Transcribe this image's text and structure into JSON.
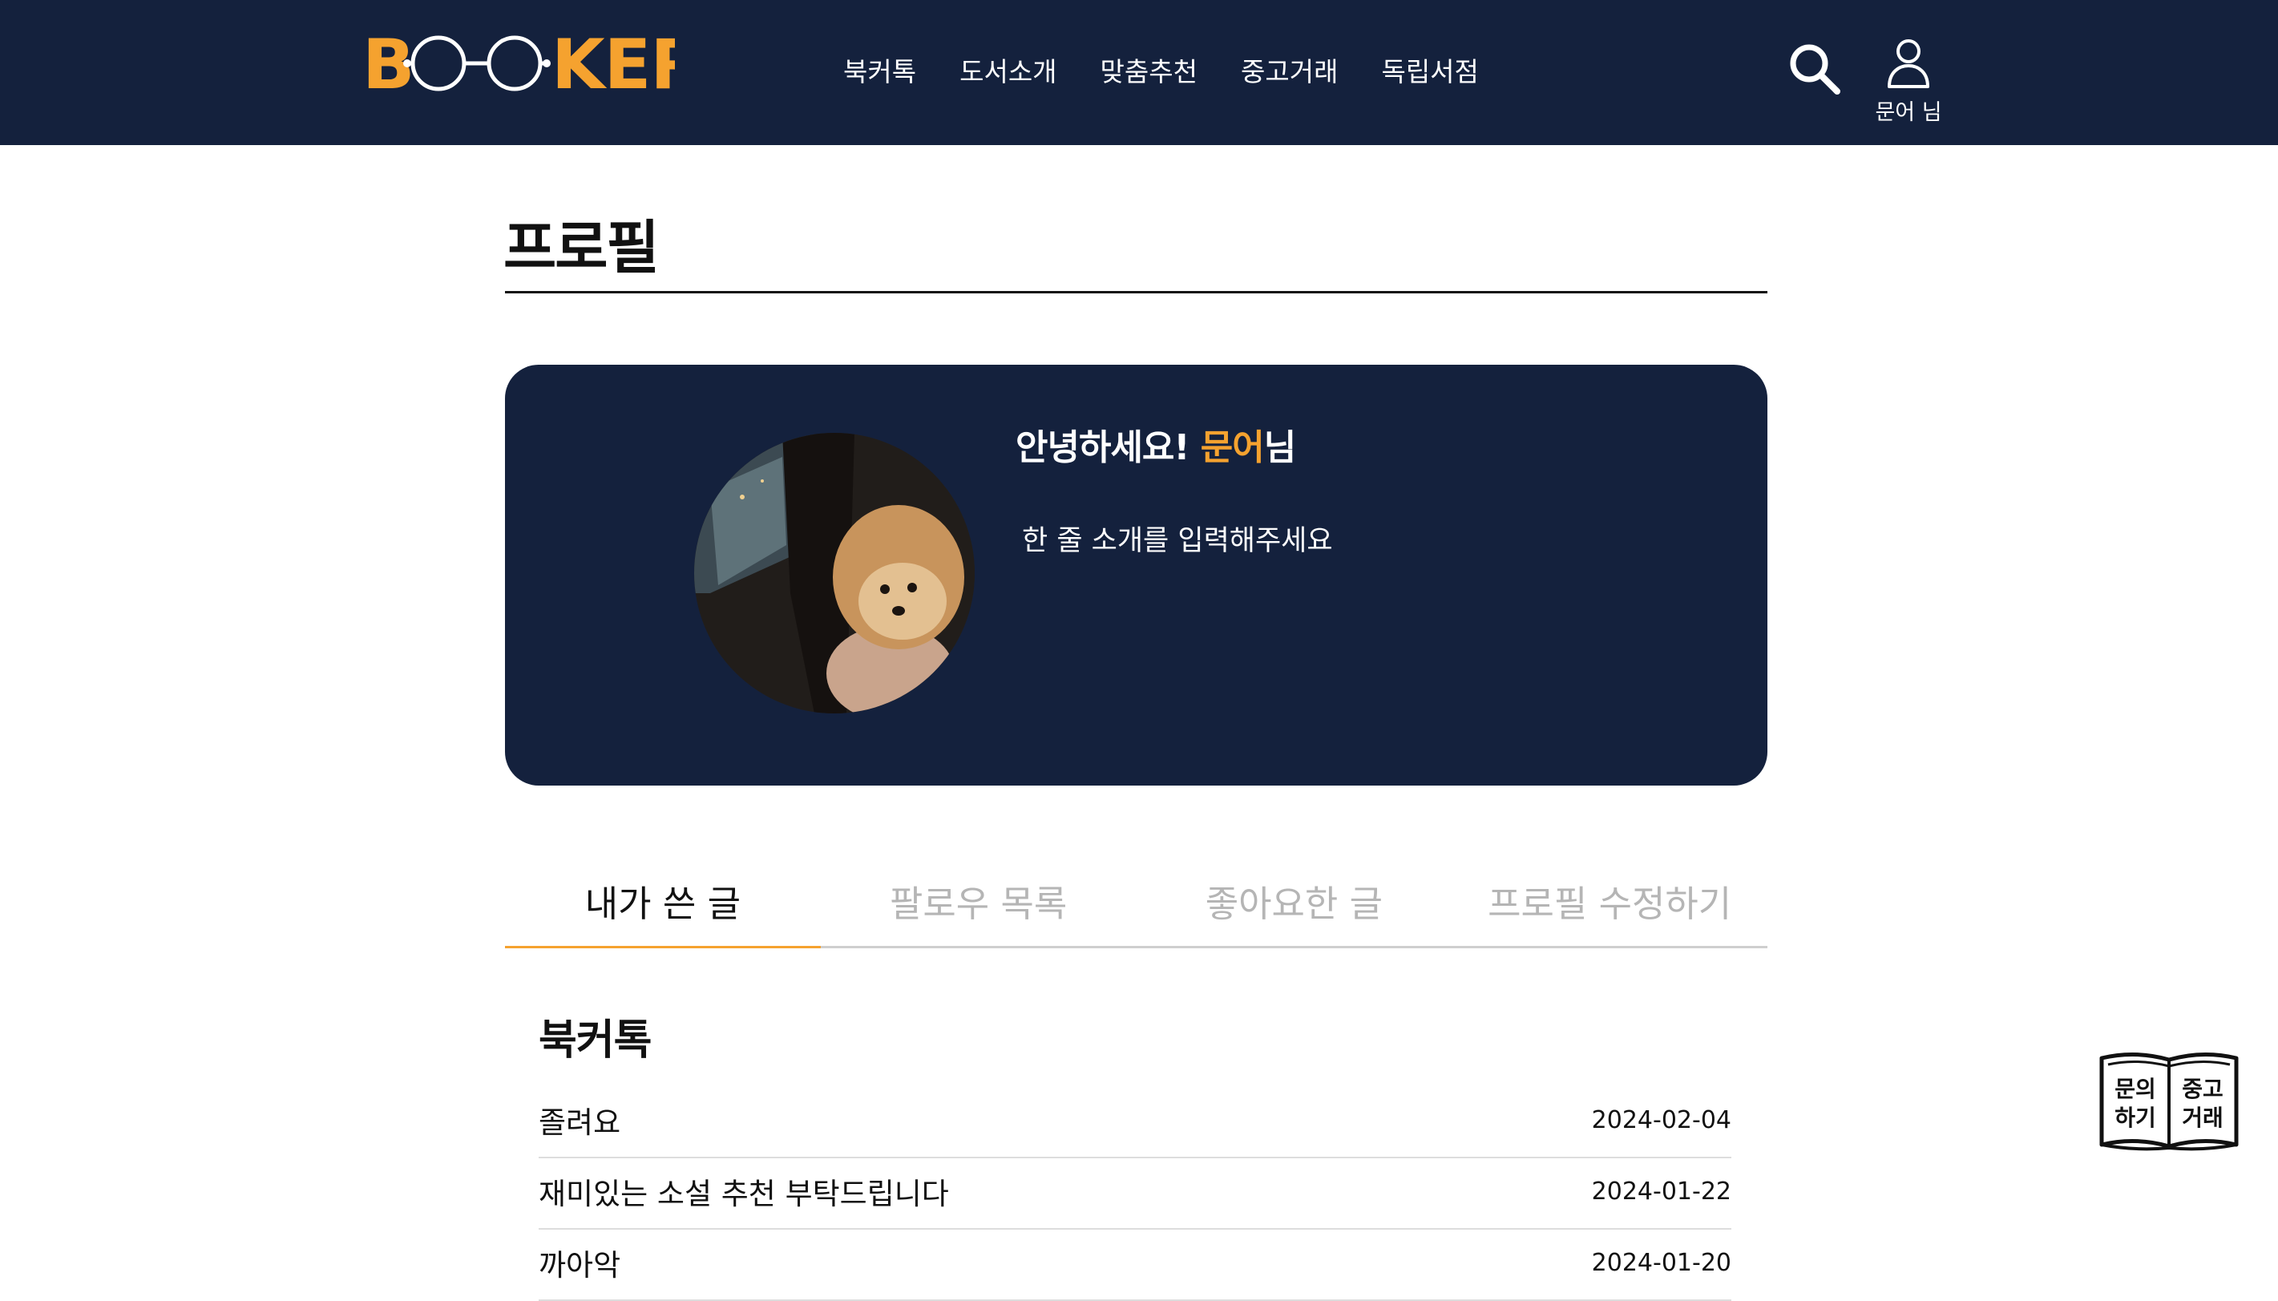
{
  "header": {
    "logo": "BOOKER",
    "nav": [
      "북커톡",
      "도서소개",
      "맞춤추천",
      "중고거래",
      "독립서점"
    ],
    "user_name": "문어 님"
  },
  "page": {
    "title": "프로필"
  },
  "profile": {
    "greeting_prefix": "안녕하세요! ",
    "nickname": "문어",
    "greeting_suffix": "님",
    "intro_placeholder": "한 줄 소개를 입력해주세요"
  },
  "tabs": [
    {
      "label": "내가 쓴 글",
      "active": true
    },
    {
      "label": "팔로우 목록",
      "active": false
    },
    {
      "label": "좋아요한 글",
      "active": false
    },
    {
      "label": "프로필 수정하기",
      "active": false
    }
  ],
  "posts": {
    "section_title": "북커톡",
    "items": [
      {
        "title": "졸려요",
        "date": "2024-02-04"
      },
      {
        "title": "재미있는 소설 추천 부탁드립니다",
        "date": "2024-01-22"
      },
      {
        "title": "까아악",
        "date": "2024-01-20"
      }
    ]
  },
  "float_button": {
    "line1_left": "문의",
    "line2_left": "하기",
    "line1_right": "중고",
    "line2_right": "거래"
  },
  "colors": {
    "navy": "#14213d",
    "accent": "#f5a22f"
  },
  "icons": [
    "search-icon",
    "user-icon",
    "book-icon"
  ]
}
